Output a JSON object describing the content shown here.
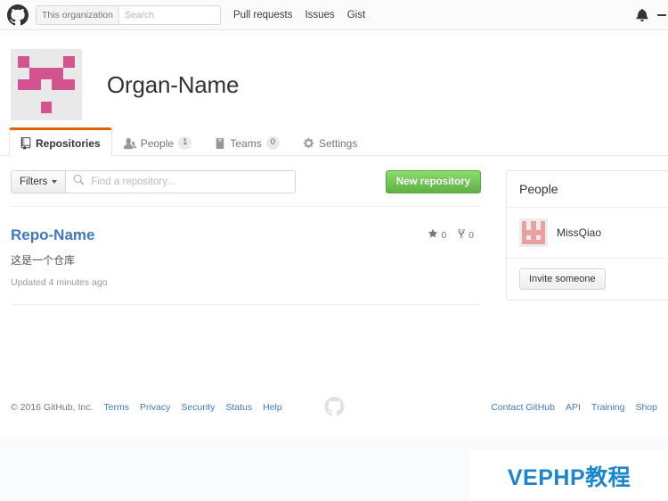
{
  "topnav": {
    "logo_icon": "github-mark-icon",
    "search": {
      "scope_label": "This organization",
      "placeholder": "Search",
      "value": ""
    },
    "links": [
      {
        "label": "Pull requests"
      },
      {
        "label": "Issues"
      },
      {
        "label": "Gist"
      }
    ],
    "notifications_icon": "bell-icon",
    "create_new_icon": "plus-icon"
  },
  "org": {
    "name": "Organ-Name",
    "avatar_icon": "identicon-avatar",
    "avatar_color": "#d2538f",
    "avatar_bg": "#e9e9e9"
  },
  "tabs": [
    {
      "label": "Repositories",
      "icon": "repo-icon",
      "count": null,
      "active": true
    },
    {
      "label": "People",
      "icon": "people-icon",
      "count": "1",
      "active": false
    },
    {
      "label": "Teams",
      "icon": "teams-icon",
      "count": "0",
      "active": false
    },
    {
      "label": "Settings",
      "icon": "gear-icon",
      "count": null,
      "active": false
    }
  ],
  "toolbar": {
    "filters_label": "Filters",
    "find_placeholder": "Find a repository...",
    "find_value": "",
    "search_icon": "search-icon",
    "new_repository_label": "New repository",
    "new_repository_color": "#60b044"
  },
  "repositories": [
    {
      "name": "Repo-Name",
      "description": "这是一个仓库",
      "updated": "Updated 4 minutes ago",
      "stars": "0",
      "forks": "0",
      "star_icon": "star-icon",
      "fork_icon": "fork-icon"
    }
  ],
  "sidebar": {
    "people_title": "People",
    "members": [
      {
        "name": "MissQiao",
        "avatar_icon": "identicon-avatar",
        "avatar_color": "#e8a0a0"
      }
    ],
    "invite_label": "Invite someone"
  },
  "footer": {
    "copyright": "© 2016 GitHub, Inc.",
    "left_links": [
      "Terms",
      "Privacy",
      "Security",
      "Status",
      "Help"
    ],
    "center_icon": "github-mark-icon",
    "right_links": [
      "Contact GitHub",
      "API",
      "Training",
      "Shop"
    ],
    "link_color": "#4078c0"
  },
  "watermark": {
    "text": "VEPHP教程",
    "color": "#1b86cf"
  }
}
